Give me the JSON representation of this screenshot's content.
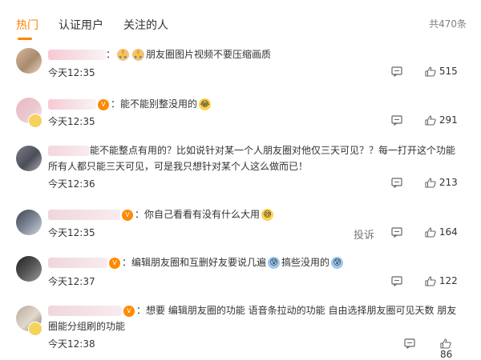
{
  "tabs": [
    {
      "label": "热门"
    },
    {
      "label": "认证用户"
    },
    {
      "label": "关注的人"
    }
  ],
  "total_count": "共470条",
  "comments": [
    {
      "text": "朋友圈图片视频不要压缩画质",
      "time": "今天12:35",
      "likes": "515",
      "prefix": "："
    },
    {
      "text": "能不能别整没用的",
      "time": "今天12:35",
      "likes": "291",
      "prefix": "："
    },
    {
      "text": "能不能整点有用的？比如说针对某一个人朋友圈对他仅三天可见？？每一打开这个功能所有人都只能三天可见，可是我只想针对某个人这么做而已！",
      "time": "今天12:36",
      "likes": "213",
      "prefix": "："
    },
    {
      "text": "你自己看看有没有什么大用",
      "time": "今天12:35",
      "likes": "164",
      "prefix": "：",
      "report": "投诉"
    },
    {
      "text_a": "编辑朋友圈和互删好友要说几遍",
      "text_b": "搞些没用的",
      "time": "今天12:37",
      "likes": "122",
      "prefix": "："
    },
    {
      "text": "想要 编辑朋友圈的功能 语音条拉动的功能 自由选择朋友圈可见天数 朋友圈能分组刷的功能",
      "time": "今天12:38",
      "likes": "86",
      "prefix": "："
    }
  ]
}
